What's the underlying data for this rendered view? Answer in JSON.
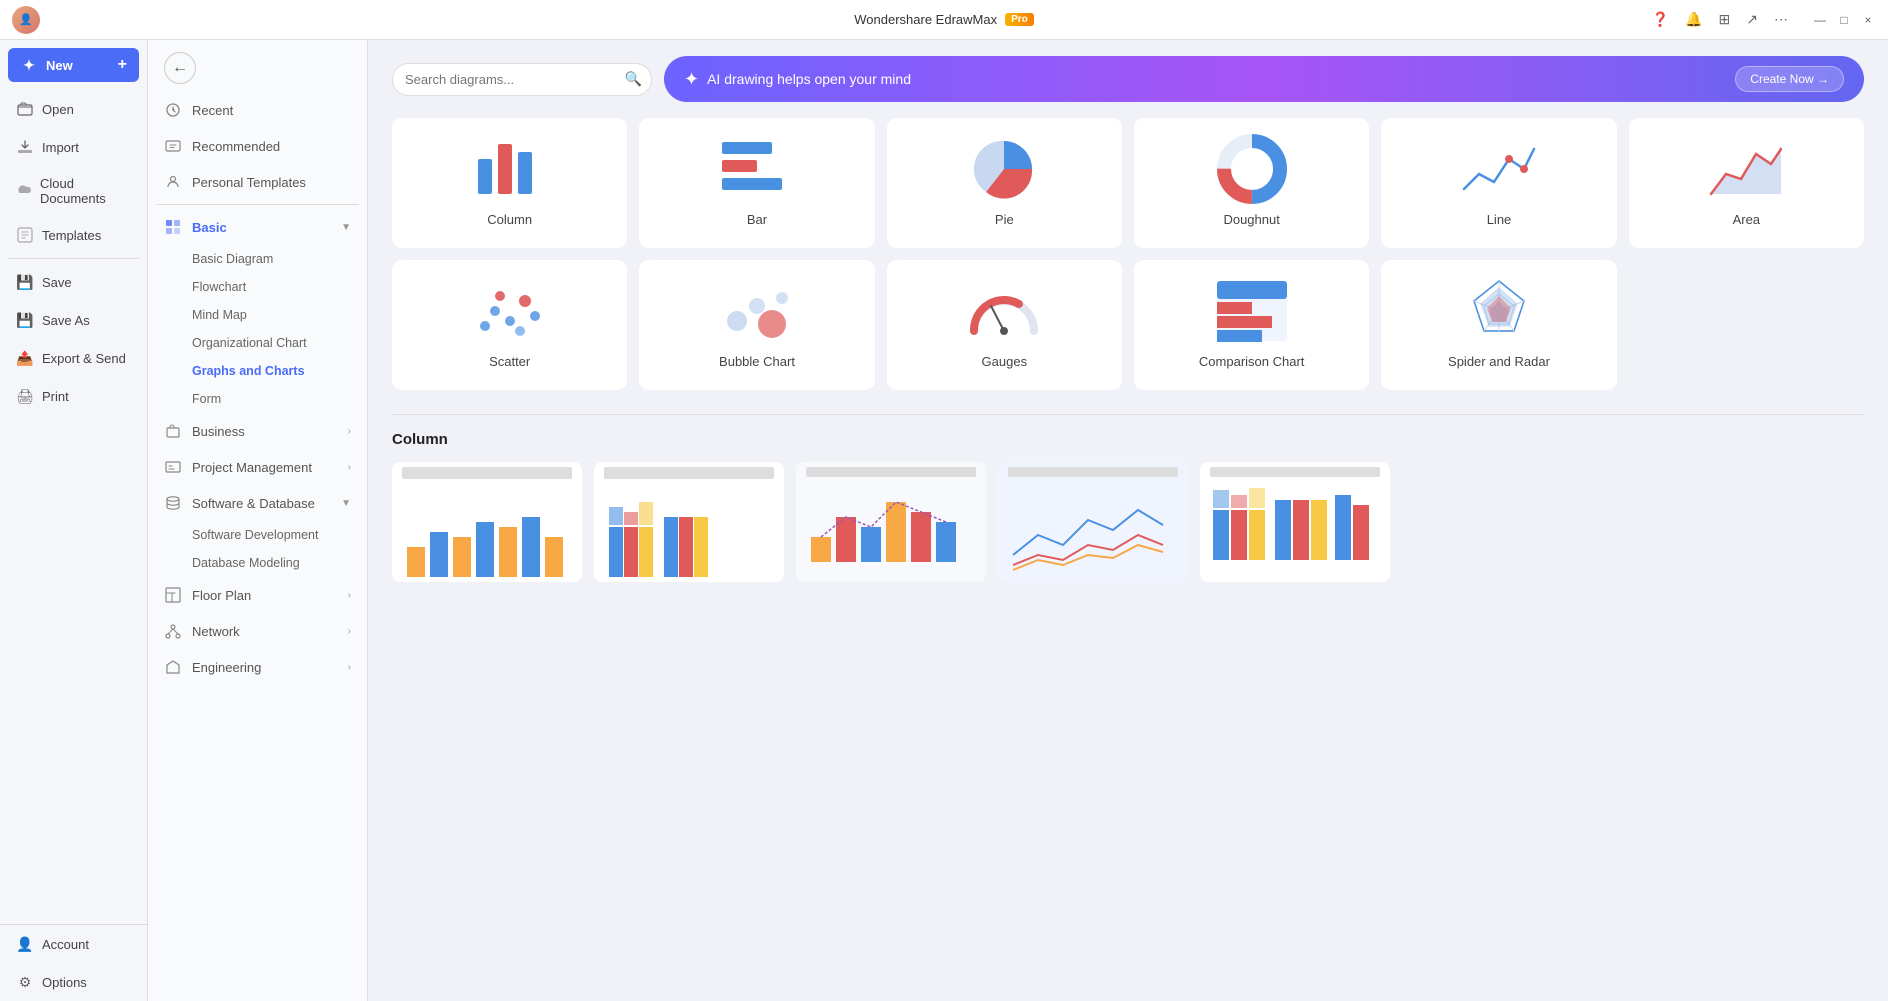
{
  "app": {
    "title": "Wondershare EdrawMax",
    "pro_badge": "Pro"
  },
  "title_bar": {
    "minimize": "—",
    "maximize": "□",
    "close": "×"
  },
  "sidebar": {
    "items": [
      {
        "id": "new",
        "label": "New",
        "icon": "➕"
      },
      {
        "id": "open",
        "label": "Open",
        "icon": "📂"
      },
      {
        "id": "import",
        "label": "Import",
        "icon": "📥"
      },
      {
        "id": "cloud",
        "label": "Cloud Documents",
        "icon": "☁"
      },
      {
        "id": "templates",
        "label": "Templates",
        "icon": "💬"
      },
      {
        "id": "save",
        "label": "Save",
        "icon": "💾"
      },
      {
        "id": "saveas",
        "label": "Save As",
        "icon": "💾"
      },
      {
        "id": "export",
        "label": "Export & Send",
        "icon": "📤"
      },
      {
        "id": "print",
        "label": "Print",
        "icon": "🖨"
      }
    ],
    "bottom": [
      {
        "id": "account",
        "label": "Account",
        "icon": "👤"
      },
      {
        "id": "options",
        "label": "Options",
        "icon": "⚙"
      }
    ]
  },
  "categories": {
    "top_items": [
      {
        "id": "recent",
        "label": "Recent"
      },
      {
        "id": "recommended",
        "label": "Recommended"
      },
      {
        "id": "personal",
        "label": "Personal Templates"
      }
    ],
    "main_items": [
      {
        "id": "basic",
        "label": "Basic",
        "has_arrow": true,
        "active": true
      },
      {
        "id": "basic_diagram",
        "label": "Basic Diagram",
        "sub": true
      },
      {
        "id": "flowchart",
        "label": "Flowchart",
        "sub": true
      },
      {
        "id": "mind_map",
        "label": "Mind Map",
        "sub": true
      },
      {
        "id": "org_chart",
        "label": "Organizational Chart",
        "sub": true
      },
      {
        "id": "graphs_charts",
        "label": "Graphs and Charts",
        "sub": true,
        "active_sub": true
      },
      {
        "id": "form",
        "label": "Form",
        "sub": true
      },
      {
        "id": "business",
        "label": "Business",
        "has_arrow": true
      },
      {
        "id": "project_mgmt",
        "label": "Project Management",
        "has_arrow": true
      },
      {
        "id": "software_db",
        "label": "Software & Database",
        "has_arrow": true
      },
      {
        "id": "software_dev",
        "label": "Software Development",
        "sub": true
      },
      {
        "id": "db_modeling",
        "label": "Database Modeling",
        "sub": true
      },
      {
        "id": "floor_plan",
        "label": "Floor Plan",
        "has_arrow": true
      },
      {
        "id": "network",
        "label": "Network",
        "has_arrow": true
      },
      {
        "id": "engineering",
        "label": "Engineering",
        "has_arrow": true
      }
    ]
  },
  "search": {
    "placeholder": "Search diagrams...",
    "value": ""
  },
  "ai_banner": {
    "text": "AI drawing helps open your mind",
    "cta": "Create Now →"
  },
  "charts_section": {
    "charts": [
      {
        "id": "column",
        "label": "Column"
      },
      {
        "id": "bar",
        "label": "Bar"
      },
      {
        "id": "pie",
        "label": "Pie"
      },
      {
        "id": "doughnut",
        "label": "Doughnut"
      },
      {
        "id": "line",
        "label": "Line"
      },
      {
        "id": "area",
        "label": "Area"
      },
      {
        "id": "scatter",
        "label": "Scatter"
      },
      {
        "id": "bubble",
        "label": "Bubble Chart"
      },
      {
        "id": "gauges",
        "label": "Gauges"
      },
      {
        "id": "comparison",
        "label": "Comparison Chart"
      },
      {
        "id": "spider",
        "label": "Spider and Radar"
      }
    ]
  },
  "column_section": {
    "title": "Column"
  }
}
